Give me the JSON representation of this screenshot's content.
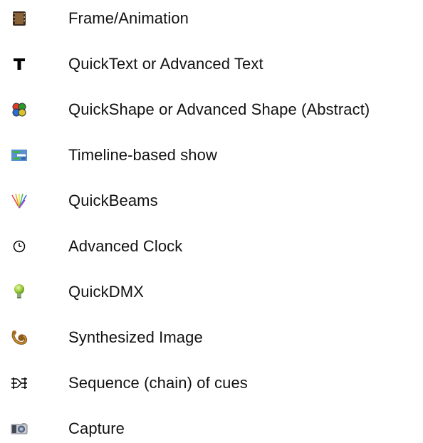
{
  "legend": {
    "items": [
      {
        "icon": "film-frame-icon",
        "label": "Frame/Animation"
      },
      {
        "icon": "text-t-icon",
        "label": "QuickText or Advanced Text"
      },
      {
        "icon": "shape-clover-icon",
        "label": "QuickShape or Advanced Shape (Abstract)"
      },
      {
        "icon": "timeline-bars-icon",
        "label": "Timeline-based show"
      },
      {
        "icon": "beams-fan-icon",
        "label": "QuickBeams"
      },
      {
        "icon": "clock-icon",
        "label": "Advanced Clock"
      },
      {
        "icon": "bulb-icon",
        "label": "QuickDMX"
      },
      {
        "icon": "synth-blob-icon",
        "label": "Synthesized Image"
      },
      {
        "icon": "sequence-chain-icon",
        "label": "Sequence (chain) of cues"
      },
      {
        "icon": "camera-icon",
        "label": "Capture"
      }
    ]
  }
}
